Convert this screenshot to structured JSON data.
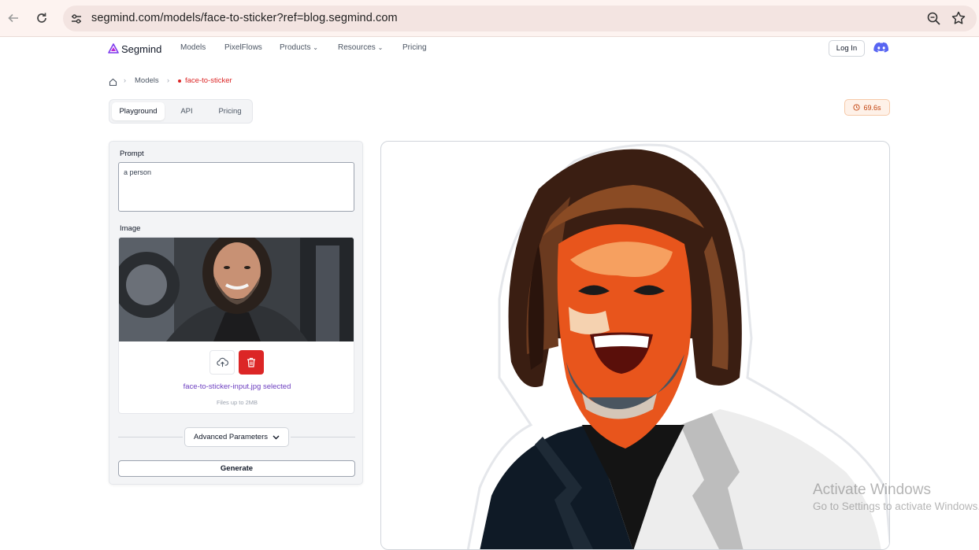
{
  "browser": {
    "url": "segmind.com/models/face-to-sticker?ref=blog.segmind.com",
    "back_icon": "arrow-back-icon",
    "reload_icon": "reload-icon"
  },
  "header": {
    "logo_text": "Segmind",
    "nav": [
      "Models",
      "PixelFlows",
      "Products",
      "Resources",
      "Pricing"
    ],
    "login_label": "Log In"
  },
  "breadcrumb": {
    "home_icon": "home-icon",
    "items": [
      "Models",
      "face-to-sticker"
    ]
  },
  "tabs": [
    "Playground",
    "API",
    "Pricing"
  ],
  "timer": "69.6s",
  "form": {
    "prompt_label": "Prompt",
    "prompt_value": "a person",
    "image_label": "Image",
    "selected_file": "face-to-sticker-input.jpg selected",
    "file_limit": "Files up to 2MB",
    "advanced_label": "Advanced Parameters",
    "generate_label": "Generate"
  },
  "watermark": {
    "title": "Activate Windows",
    "subtitle": "Go to Settings to activate Windows."
  },
  "colors": {
    "accent_red": "#dc2626",
    "filename_purple": "#6d3fc0",
    "timer_orange": "#c2410c",
    "discord": "#5865f2"
  }
}
